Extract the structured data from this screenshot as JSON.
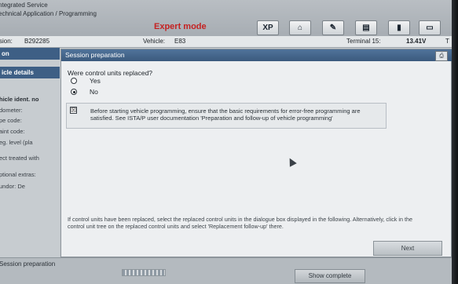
{
  "header": {
    "brand_line1": "ntegrated Service",
    "brand_line2": "echnical Application / Programming",
    "mode_label": "Expert mode",
    "toolbar": [
      {
        "label": "XP",
        "icon": "xp-icon"
      },
      {
        "label": "⌂",
        "icon": "home-icon"
      },
      {
        "label": "✎",
        "icon": "wrench-icon"
      },
      {
        "label": "▤",
        "icon": "tree-icon"
      },
      {
        "label": "▮",
        "icon": "battery-icon"
      },
      {
        "label": "▭",
        "icon": "monitor-icon"
      }
    ]
  },
  "infobar": {
    "session_label": "sion:",
    "session_value": "B292285",
    "vehicle_label": "Vehicle:",
    "vehicle_value": "E83",
    "terminal_label": "Terminal 15:",
    "terminal_value": "13.41V",
    "trail": "T"
  },
  "left_panel": {
    "top_heading": "on",
    "section_heading": "icle details",
    "fields": [
      "hicle ident. no",
      "dometer:",
      "pe code:",
      "aint code:",
      "eg. level (pla",
      "ect treated with",
      "ptional extras:",
      "undor:       De"
    ]
  },
  "dialog": {
    "title": "Session preparation",
    "question": "Were control units replaced?",
    "options": [
      {
        "label": "Yes",
        "selected": false
      },
      {
        "label": "No",
        "selected": true
      }
    ],
    "notice_icon": "☒",
    "notice": "Before starting vehicle programming, ensure that the basic requirements for error-free programming are satisfied. See ISTA/P user documentation 'Preparation and follow-up of vehicle programming'",
    "hint": "If control units have been replaced, select the replaced control units in the dialogue box displayed in the following. Alternatively, click in the control unit tree on the replaced control units and select 'Replacement follow-up' there.",
    "next_label": "Next"
  },
  "status": {
    "label": "Session preparation",
    "show_complete_label": "Show complete"
  }
}
